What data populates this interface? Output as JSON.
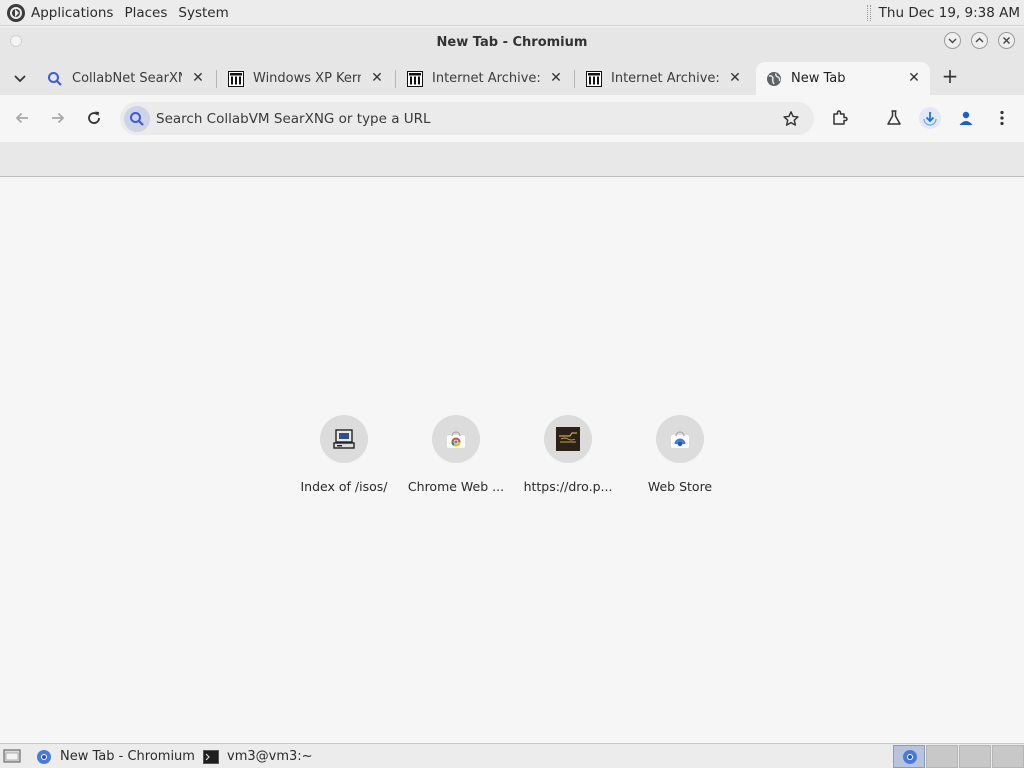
{
  "system_panel": {
    "menus": [
      "Applications",
      "Places",
      "System"
    ],
    "clock": "Thu Dec 19,  9:38 AM"
  },
  "window": {
    "title": "New Tab - Chromium"
  },
  "tabs": [
    {
      "title": "CollabNet SearXNG",
      "icon": "search-icon"
    },
    {
      "title": "Windows XP Kernel",
      "icon": "archive-icon"
    },
    {
      "title": "Internet Archive: D",
      "icon": "archive-icon"
    },
    {
      "title": "Internet Archive: D",
      "icon": "archive-icon"
    },
    {
      "title": "New Tab",
      "icon": "globe-icon",
      "active": true
    }
  ],
  "omnibox": {
    "placeholder": "Search CollabVM SearXNG or type a URL"
  },
  "shortcuts": [
    {
      "label": "Index of /isos/",
      "icon": "computer-icon"
    },
    {
      "label": "Chrome Web ...",
      "icon": "chrome-webstore-icon"
    },
    {
      "label": "https://dro.p...",
      "icon": "site-thumbnail-icon"
    },
    {
      "label": "Web Store",
      "icon": "webstore-icon"
    }
  ],
  "taskbar": {
    "items": [
      {
        "label": "New Tab - Chromium",
        "icon": "chromium-icon"
      },
      {
        "label": "vm3@vm3:~",
        "icon": "terminal-icon"
      }
    ]
  },
  "colors": {
    "accent": "#1a73e8",
    "panel": "#ececec",
    "content_bg": "#f6f6f6"
  }
}
